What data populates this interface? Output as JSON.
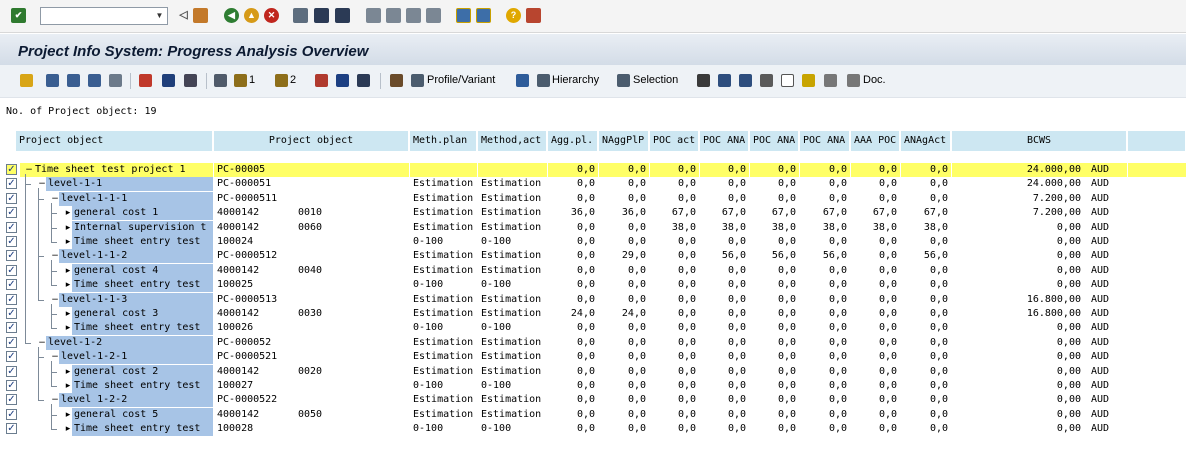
{
  "toolbar": {
    "command_field": {
      "value": "",
      "placeholder": ""
    },
    "icons": [
      "enter-icon",
      "dropdown-icon",
      "back-icon",
      "save-icon",
      "back-arrow-icon",
      "exit-icon",
      "cancel-icon",
      "print-icon",
      "find-icon",
      "find-next-icon",
      "first-page-icon",
      "prev-page-icon",
      "next-page-icon",
      "last-page-icon",
      "new-session-icon",
      "shortcut-icon",
      "help-icon",
      "layout-icon"
    ]
  },
  "title": "Project Info System: Progress Analysis Overview",
  "app_toolbar": {
    "profile_variant": "Profile/Variant",
    "hierarchy": "Hierarchy",
    "selection": "Selection",
    "doc": "Doc.",
    "badge_1": "1",
    "badge_2": "2"
  },
  "count_text": "No. of Project object: 19",
  "columns": {
    "tree": "Project object",
    "id": "Project object",
    "meth_plan": "Meth.plan",
    "method_act": "Method,act",
    "agg_pl": "Agg.pl.",
    "nagg": "NAggPlP",
    "poc_act": "POC act",
    "poc_ana1": "POC ANA",
    "poc_ana2": "POC ANA",
    "poc_ana3": "POC ANA",
    "aaa_poc": "AAA POC",
    "anagact": "ANAgAct",
    "bcws": "BCWS"
  },
  "rows": [
    {
      "label": "Time sheet test project 1",
      "id": "PC-00005",
      "item": "",
      "mp": "",
      "ma": "",
      "v1": "0,0",
      "v2": "0,0",
      "v3": "0,0",
      "v4": "0,0",
      "v5": "0,0",
      "v6": "0,0",
      "v7": "0,0",
      "v8": "0,0",
      "bcws": "24.000,00",
      "cur": "AUD"
    },
    {
      "label": "level-1-1",
      "id": "PC-000051",
      "item": "",
      "mp": "Estimation",
      "ma": "Estimation",
      "v1": "0,0",
      "v2": "0,0",
      "v3": "0,0",
      "v4": "0,0",
      "v5": "0,0",
      "v6": "0,0",
      "v7": "0,0",
      "v8": "0,0",
      "bcws": "24.000,00",
      "cur": "AUD"
    },
    {
      "label": "level-1-1-1",
      "id": "PC-0000511",
      "item": "",
      "mp": "Estimation",
      "ma": "Estimation",
      "v1": "0,0",
      "v2": "0,0",
      "v3": "0,0",
      "v4": "0,0",
      "v5": "0,0",
      "v6": "0,0",
      "v7": "0,0",
      "v8": "0,0",
      "bcws": "7.200,00",
      "cur": "AUD"
    },
    {
      "label": "general cost 1",
      "id": "4000142",
      "item": "0010",
      "mp": "Estimation",
      "ma": "Estimation",
      "v1": "36,0",
      "v2": "36,0",
      "v3": "67,0",
      "v4": "67,0",
      "v5": "67,0",
      "v6": "67,0",
      "v7": "67,0",
      "v8": "67,0",
      "bcws": "7.200,00",
      "cur": "AUD"
    },
    {
      "label": "Internal supervision t",
      "id": "4000142",
      "item": "0060",
      "mp": "Estimation",
      "ma": "Estimation",
      "v1": "0,0",
      "v2": "0,0",
      "v3": "38,0",
      "v4": "38,0",
      "v5": "38,0",
      "v6": "38,0",
      "v7": "38,0",
      "v8": "38,0",
      "bcws": "0,00",
      "cur": "AUD"
    },
    {
      "label": "Time sheet entry test",
      "id": "100024",
      "item": "",
      "mp": "0-100",
      "ma": "0-100",
      "v1": "0,0",
      "v2": "0,0",
      "v3": "0,0",
      "v4": "0,0",
      "v5": "0,0",
      "v6": "0,0",
      "v7": "0,0",
      "v8": "0,0",
      "bcws": "0,00",
      "cur": "AUD"
    },
    {
      "label": "level-1-1-2",
      "id": "PC-0000512",
      "item": "",
      "mp": "Estimation",
      "ma": "Estimation",
      "v1": "0,0",
      "v2": "29,0",
      "v3": "0,0",
      "v4": "56,0",
      "v5": "56,0",
      "v6": "56,0",
      "v7": "0,0",
      "v8": "56,0",
      "bcws": "0,00",
      "cur": "AUD"
    },
    {
      "label": "general cost 4",
      "id": "4000142",
      "item": "0040",
      "mp": "Estimation",
      "ma": "Estimation",
      "v1": "0,0",
      "v2": "0,0",
      "v3": "0,0",
      "v4": "0,0",
      "v5": "0,0",
      "v6": "0,0",
      "v7": "0,0",
      "v8": "0,0",
      "bcws": "0,00",
      "cur": "AUD"
    },
    {
      "label": "Time sheet entry test",
      "id": "100025",
      "item": "",
      "mp": "0-100",
      "ma": "0-100",
      "v1": "0,0",
      "v2": "0,0",
      "v3": "0,0",
      "v4": "0,0",
      "v5": "0,0",
      "v6": "0,0",
      "v7": "0,0",
      "v8": "0,0",
      "bcws": "0,00",
      "cur": "AUD"
    },
    {
      "label": "level-1-1-3",
      "id": "PC-0000513",
      "item": "",
      "mp": "Estimation",
      "ma": "Estimation",
      "v1": "0,0",
      "v2": "0,0",
      "v3": "0,0",
      "v4": "0,0",
      "v5": "0,0",
      "v6": "0,0",
      "v7": "0,0",
      "v8": "0,0",
      "bcws": "16.800,00",
      "cur": "AUD"
    },
    {
      "label": "general cost 3",
      "id": "4000142",
      "item": "0030",
      "mp": "Estimation",
      "ma": "Estimation",
      "v1": "24,0",
      "v2": "24,0",
      "v3": "0,0",
      "v4": "0,0",
      "v5": "0,0",
      "v6": "0,0",
      "v7": "0,0",
      "v8": "0,0",
      "bcws": "16.800,00",
      "cur": "AUD"
    },
    {
      "label": "Time sheet entry test",
      "id": "100026",
      "item": "",
      "mp": "0-100",
      "ma": "0-100",
      "v1": "0,0",
      "v2": "0,0",
      "v3": "0,0",
      "v4": "0,0",
      "v5": "0,0",
      "v6": "0,0",
      "v7": "0,0",
      "v8": "0,0",
      "bcws": "0,00",
      "cur": "AUD"
    },
    {
      "label": "level-1-2",
      "id": "PC-000052",
      "item": "",
      "mp": "Estimation",
      "ma": "Estimation",
      "v1": "0,0",
      "v2": "0,0",
      "v3": "0,0",
      "v4": "0,0",
      "v5": "0,0",
      "v6": "0,0",
      "v7": "0,0",
      "v8": "0,0",
      "bcws": "0,00",
      "cur": "AUD"
    },
    {
      "label": "level-1-2-1",
      "id": "PC-0000521",
      "item": "",
      "mp": "Estimation",
      "ma": "Estimation",
      "v1": "0,0",
      "v2": "0,0",
      "v3": "0,0",
      "v4": "0,0",
      "v5": "0,0",
      "v6": "0,0",
      "v7": "0,0",
      "v8": "0,0",
      "bcws": "0,00",
      "cur": "AUD"
    },
    {
      "label": "general cost 2",
      "id": "4000142",
      "item": "0020",
      "mp": "Estimation",
      "ma": "Estimation",
      "v1": "0,0",
      "v2": "0,0",
      "v3": "0,0",
      "v4": "0,0",
      "v5": "0,0",
      "v6": "0,0",
      "v7": "0,0",
      "v8": "0,0",
      "bcws": "0,00",
      "cur": "AUD"
    },
    {
      "label": "Time sheet entry test",
      "id": "100027",
      "item": "",
      "mp": "0-100",
      "ma": "0-100",
      "v1": "0,0",
      "v2": "0,0",
      "v3": "0,0",
      "v4": "0,0",
      "v5": "0,0",
      "v6": "0,0",
      "v7": "0,0",
      "v8": "0,0",
      "bcws": "0,00",
      "cur": "AUD"
    },
    {
      "label": "level 1-2-2",
      "id": "PC-0000522",
      "item": "",
      "mp": "Estimation",
      "ma": "Estimation",
      "v1": "0,0",
      "v2": "0,0",
      "v3": "0,0",
      "v4": "0,0",
      "v5": "0,0",
      "v6": "0,0",
      "v7": "0,0",
      "v8": "0,0",
      "bcws": "0,00",
      "cur": "AUD"
    },
    {
      "label": "general cost 5",
      "id": "4000142",
      "item": "0050",
      "mp": "Estimation",
      "ma": "Estimation",
      "v1": "0,0",
      "v2": "0,0",
      "v3": "0,0",
      "v4": "0,0",
      "v5": "0,0",
      "v6": "0,0",
      "v7": "0,0",
      "v8": "0,0",
      "bcws": "0,00",
      "cur": "AUD"
    },
    {
      "label": "Time sheet entry test",
      "id": "100028",
      "item": "",
      "mp": "0-100",
      "ma": "0-100",
      "v1": "0,0",
      "v2": "0,0",
      "v3": "0,0",
      "v4": "0,0",
      "v5": "0,0",
      "v6": "0,0",
      "v7": "0,0",
      "v8": "0,0",
      "bcws": "0,00",
      "cur": "AUD"
    }
  ],
  "colors": {
    "header_bg": "#cde7f2",
    "tree_label_bg": "#a7c4e6",
    "highlight_row": "#ffff66"
  }
}
